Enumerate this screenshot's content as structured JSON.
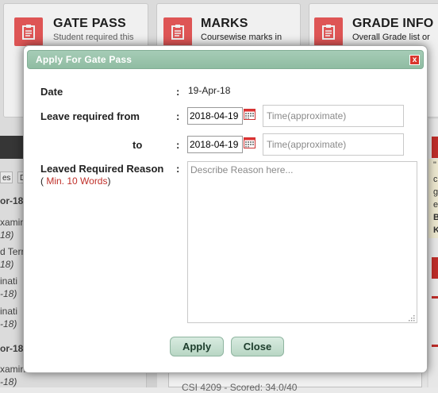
{
  "cards": [
    {
      "title": "GATE PASS",
      "subtitle": "Student required this"
    },
    {
      "title": "MARKS",
      "subtitle": "Coursewise marks in"
    },
    {
      "title": "GRADE INFO",
      "subtitle": "Overall Grade list or"
    }
  ],
  "background": {
    "tabs": [
      "es",
      "D"
    ],
    "list": [
      "or-18",
      "xamin",
      "18)",
      "d Terr",
      "18)",
      "inati",
      "-18)",
      "inati",
      "-18)",
      "or-18",
      "xamin",
      "-18)"
    ],
    "bottom_text": "CSI 4209 - Scored: 34.0/40",
    "right_chars": [
      "\"",
      "c",
      "g",
      "e",
      "B",
      "K"
    ]
  },
  "dialog": {
    "title": "Apply For Gate Pass",
    "close_label": "x",
    "date_label": "Date",
    "date_value": "19-Apr-18",
    "leave_from_label": "Leave required from",
    "leave_from_date": "2018-04-19",
    "leave_from_time_placeholder": "Time(approximate)",
    "to_label": "to",
    "to_date": "2018-04-19",
    "to_time_placeholder": "Time(approximate)",
    "reason_label": "Leaved Required Reason",
    "reason_hint_open": "(",
    "reason_hint_red": "Min. 10 Words",
    "reason_hint_close": ")",
    "reason_placeholder": "Describe Reason here...",
    "colon": ":",
    "apply_label": "Apply",
    "close_button_label": "Close"
  },
  "colors": {
    "titlebar": "#8fbca2",
    "card_icon": "#ec5b5b",
    "close_x": "#d9352c",
    "hint_red": "#c0302a"
  },
  "icons": {
    "card_icon": "clipboard-icon",
    "date_picker": "calendar-icon",
    "resize": "resize-grip-icon"
  }
}
